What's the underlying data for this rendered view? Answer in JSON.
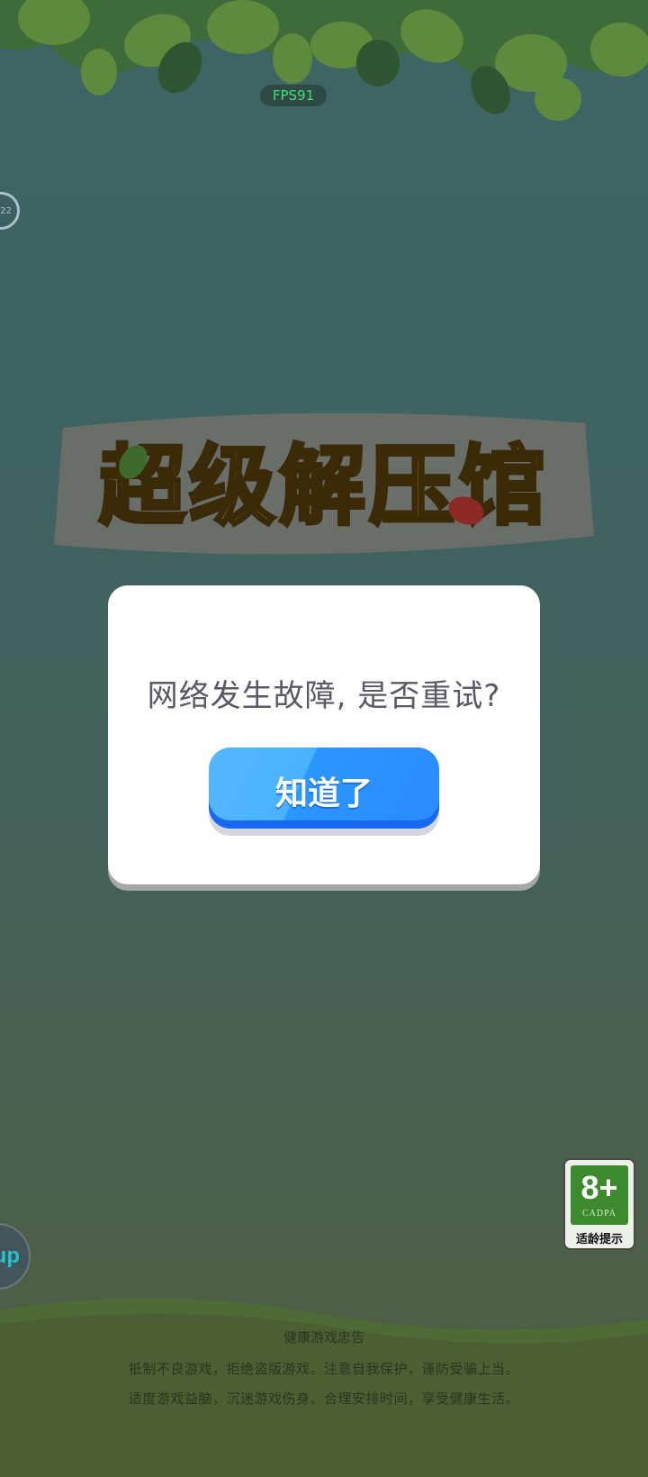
{
  "hud": {
    "fps_label": "FPS91",
    "level_badge_text": "22"
  },
  "title": {
    "logo_text": "超级解压馆"
  },
  "dialog": {
    "message": "网络发生故障, 是否重试?",
    "confirm_label": "知道了"
  },
  "age_rating": {
    "value": "8+",
    "org": "CADPA",
    "caption": "适龄提示"
  },
  "side_button": {
    "label": "up"
  },
  "health_notice": {
    "title": "健康游戏忠告",
    "line1": "抵制不良游戏，拒绝盗版游戏。注意自我保护，谨防受骗上当。",
    "line2": "适度游戏益脑，沉迷游戏伤身。合理安排时间，享受健康生活。"
  },
  "colors": {
    "background_top": "#3e6464",
    "background_bottom": "#4f5f3e",
    "button_blue": "#2a8bff",
    "logo_gold": "#c89a1c",
    "age_green": "#3d8a2e"
  }
}
